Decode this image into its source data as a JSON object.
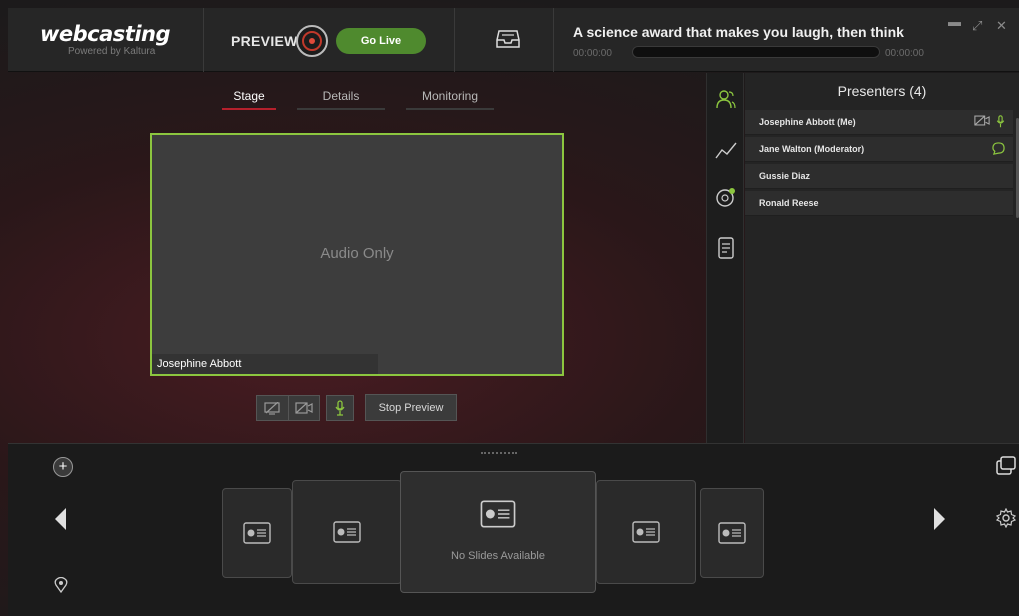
{
  "header": {
    "logo_text": "webcasting",
    "logo_sub": "Powered by Kaltura",
    "preview_label": "PREVIEW",
    "go_live_label": "Go Live",
    "event_title": "A science award that makes you laugh, then think",
    "time_start": "00:00:00",
    "time_end": "00:00:00",
    "window_controls": [
      "minimize-icon",
      "expand-icon",
      "close-icon"
    ]
  },
  "tabs": [
    {
      "label": "Stage",
      "active": true
    },
    {
      "label": "Details",
      "active": false
    },
    {
      "label": "Monitoring",
      "active": false
    }
  ],
  "stage": {
    "audio_only_label": "Audio Only",
    "presenter_name": "Josephine Abbott",
    "stop_preview_label": "Stop Preview"
  },
  "side_icons": [
    "presenters-icon",
    "analytics-icon",
    "chat-icon",
    "notes-icon"
  ],
  "presenters": {
    "title": "Presenters (4)",
    "items": [
      {
        "name": "Josephine Abbott (Me)",
        "icons": [
          "camera-off-icon",
          "mic-icon"
        ]
      },
      {
        "name": "Jane Walton (Moderator)",
        "icons": [
          "chat-bubble-icon"
        ]
      },
      {
        "name": "Gussie Diaz",
        "icons": []
      },
      {
        "name": "Ronald Reese",
        "icons": []
      }
    ]
  },
  "slides": {
    "no_slides_label": "No Slides Available"
  },
  "colors": {
    "accent_green": "#8cc63f",
    "go_live_green": "#4f8a2e",
    "tab_active_red": "#b5202c"
  }
}
